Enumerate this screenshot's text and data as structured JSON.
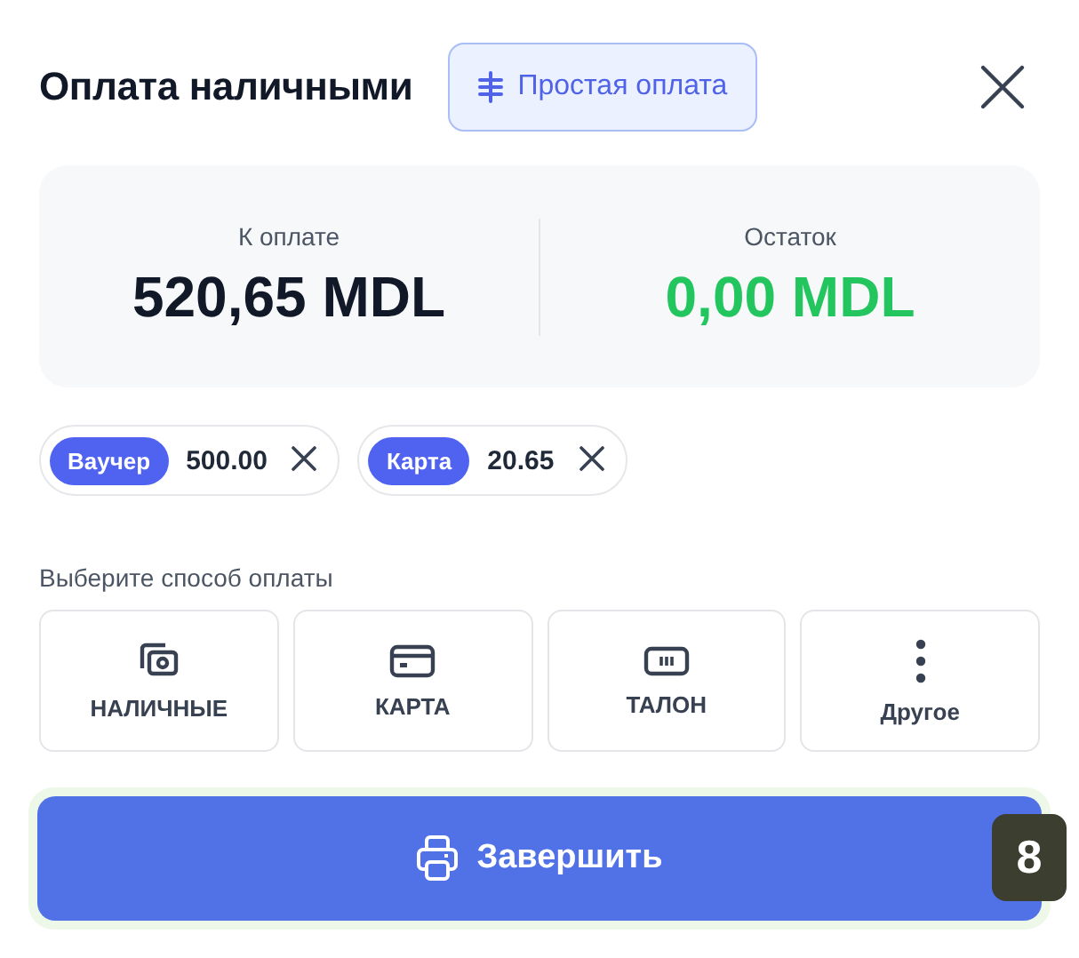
{
  "header": {
    "title": "Оплата наличными",
    "mode_button": "Простая оплата"
  },
  "summary": [
    {
      "kind": "due",
      "label": "К оплате",
      "amount": "520,65 MDL"
    },
    {
      "kind": "remaining",
      "label": "Остаток",
      "amount": "0,00 MDL"
    }
  ],
  "payments": [
    {
      "type": "Ваучер",
      "amount": "500.00"
    },
    {
      "type": "Карта",
      "amount": "20.65"
    }
  ],
  "methods_label": "Выберите способ оплаты",
  "methods": [
    {
      "kind": "cash",
      "label": "НАЛИЧНЫЕ"
    },
    {
      "kind": "card",
      "label": "КАРТА"
    },
    {
      "kind": "voucher",
      "label": "ТАЛОН"
    },
    {
      "kind": "other",
      "label": "Другое"
    }
  ],
  "finish_button": {
    "label": "Завершить",
    "badge": "8"
  }
}
